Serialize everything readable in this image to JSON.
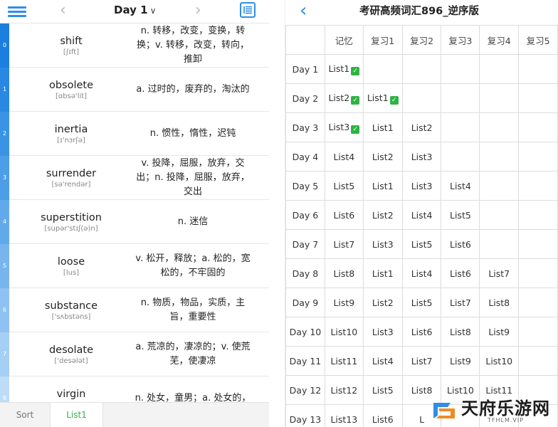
{
  "left": {
    "header": {
      "day_label": "Day 1",
      "caret": "∨",
      "prev": "‹",
      "next": "›"
    },
    "words": [
      {
        "index": "0",
        "word": "shift",
        "phonetic": "[ʃɪft]",
        "definition": "n. 转移，改变，变换，转换；v. 转移，改变，转向，推卸",
        "idx_color": "#1c7fe0"
      },
      {
        "index": "1",
        "word": "obsolete",
        "phonetic": "[ɑbsə'lit]",
        "definition": "a. 过时的，废弃的，淘汰的",
        "idx_color": "#2a88e3"
      },
      {
        "index": "2",
        "word": "inertia",
        "phonetic": "[ɪ'nɜrʃə]",
        "definition": "n. 惯性，惰性，迟钝",
        "idx_color": "#3b93e6"
      },
      {
        "index": "3",
        "word": "surrender",
        "phonetic": "[sə'rendər]",
        "definition": "v. 投降，屈服，放弃，交出；n. 投降，屈服，放弃，交出",
        "idx_color": "#4d9de9"
      },
      {
        "index": "4",
        "word": "superstition",
        "phonetic": "[supər'stɪʃ(ə)n]",
        "definition": "n. 迷信",
        "idx_color": "#62a9ec"
      },
      {
        "index": "5",
        "word": "loose",
        "phonetic": "[lus]",
        "definition": "v. 松开，释放；a. 松的，宽松的，不牢固的",
        "idx_color": "#78b5ef"
      },
      {
        "index": "6",
        "word": "substance",
        "phonetic": "['sʌbstəns]",
        "definition": "n. 物质，物品，实质，主旨，重要性",
        "idx_color": "#8fc2f2"
      },
      {
        "index": "7",
        "word": "desolate",
        "phonetic": "['desələt]",
        "definition": "a. 荒凉的，凄凉的；v. 使荒芜，使凄凉",
        "idx_color": "#a6cff5"
      },
      {
        "index": "8",
        "word": "virgin",
        "phonetic": "",
        "definition": "n. 处女，童男；a. 处女的，",
        "idx_color": "#bedcf8"
      }
    ],
    "tabs": {
      "sort": "Sort",
      "list1": "List1"
    }
  },
  "right": {
    "title": "考研高频词汇896_逆序版",
    "back": "‹",
    "columns": [
      "",
      "记忆",
      "复习1",
      "复习2",
      "复习3",
      "复习4",
      "复习5"
    ],
    "rows": [
      {
        "day": "Day 1",
        "cells": [
          "List1",
          "",
          "",
          "",
          "",
          ""
        ],
        "checks": [
          true,
          false,
          false,
          false,
          false,
          false
        ]
      },
      {
        "day": "Day 2",
        "cells": [
          "List2",
          "List1",
          "",
          "",
          "",
          ""
        ],
        "checks": [
          true,
          true,
          false,
          false,
          false,
          false
        ]
      },
      {
        "day": "Day 3",
        "cells": [
          "List3",
          "List1",
          "List2",
          "",
          "",
          ""
        ],
        "checks": [
          true,
          false,
          false,
          false,
          false,
          false
        ]
      },
      {
        "day": "Day 4",
        "cells": [
          "List4",
          "List2",
          "List3",
          "",
          "",
          ""
        ],
        "checks": [
          false,
          false,
          false,
          false,
          false,
          false
        ]
      },
      {
        "day": "Day 5",
        "cells": [
          "List5",
          "List1",
          "List3",
          "List4",
          "",
          ""
        ],
        "checks": [
          false,
          false,
          false,
          false,
          false,
          false
        ]
      },
      {
        "day": "Day 6",
        "cells": [
          "List6",
          "List2",
          "List4",
          "List5",
          "",
          ""
        ],
        "checks": [
          false,
          false,
          false,
          false,
          false,
          false
        ]
      },
      {
        "day": "Day 7",
        "cells": [
          "List7",
          "List3",
          "List5",
          "List6",
          "",
          ""
        ],
        "checks": [
          false,
          false,
          false,
          false,
          false,
          false
        ]
      },
      {
        "day": "Day 8",
        "cells": [
          "List8",
          "List1",
          "List4",
          "List6",
          "List7",
          ""
        ],
        "checks": [
          false,
          false,
          false,
          false,
          false,
          false
        ]
      },
      {
        "day": "Day 9",
        "cells": [
          "List9",
          "List2",
          "List5",
          "List7",
          "List8",
          ""
        ],
        "checks": [
          false,
          false,
          false,
          false,
          false,
          false
        ]
      },
      {
        "day": "Day 10",
        "cells": [
          "List10",
          "List3",
          "List6",
          "List8",
          "List9",
          ""
        ],
        "checks": [
          false,
          false,
          false,
          false,
          false,
          false
        ]
      },
      {
        "day": "Day 11",
        "cells": [
          "List11",
          "List4",
          "List7",
          "List9",
          "List10",
          ""
        ],
        "checks": [
          false,
          false,
          false,
          false,
          false,
          false
        ]
      },
      {
        "day": "Day 12",
        "cells": [
          "List12",
          "List5",
          "List8",
          "List10",
          "List11",
          ""
        ],
        "checks": [
          false,
          false,
          false,
          false,
          false,
          false
        ]
      },
      {
        "day": "Day 13",
        "cells": [
          "List13",
          "List6",
          "L",
          "",
          "",
          ""
        ],
        "checks": [
          false,
          false,
          false,
          false,
          false,
          false
        ]
      }
    ]
  },
  "watermark": {
    "text": "天府乐游网",
    "sub": "TFHLM.VIP"
  },
  "colors": {
    "accent": "#2f8ee5",
    "check": "#2fb344",
    "tab_active": "#2fb344"
  },
  "icons": {
    "menu": "hamburger-menu-icon",
    "list": "list-view-icon",
    "back": "back-arrow-icon"
  }
}
